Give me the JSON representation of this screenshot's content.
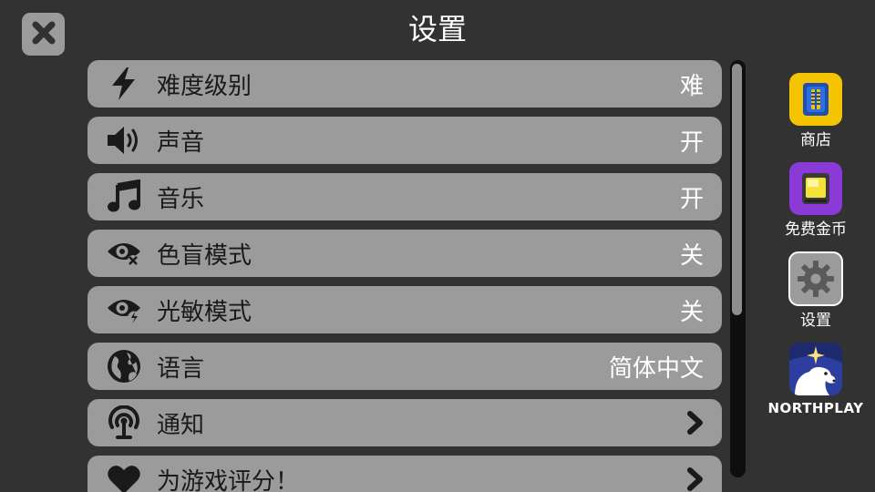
{
  "header": {
    "title": "设置"
  },
  "settings": [
    {
      "label": "难度级别",
      "value": "难",
      "icon": "lightning-icon"
    },
    {
      "label": "声音",
      "value": "开",
      "icon": "speaker-icon"
    },
    {
      "label": "音乐",
      "value": "开",
      "icon": "music-note-icon"
    },
    {
      "label": "色盲模式",
      "value": "关",
      "icon": "eye-colorblind-icon"
    },
    {
      "label": "光敏模式",
      "value": "关",
      "icon": "eye-photosensitive-icon"
    },
    {
      "label": "语言",
      "value": "简体中文",
      "icon": "globe-icon"
    },
    {
      "label": "通知",
      "value": "",
      "icon": "notification-icon"
    },
    {
      "label": "为游戏评分！",
      "value": "",
      "icon": "heart-icon"
    }
  ],
  "sidebar": {
    "shop": {
      "label": "商店",
      "icon": "shop-icon",
      "color": "#f5c400"
    },
    "free_coins": {
      "label": "免费金币",
      "icon": "tv-coins-icon",
      "color": "#8a3ad6"
    },
    "settings": {
      "label": "设置",
      "icon": "gear-icon",
      "color": "#9b9b9b"
    },
    "northplay": {
      "label": "NORTHPLAY",
      "icon": "northplay-logo-icon",
      "color": "#2c3f9e"
    }
  },
  "colors": {
    "background": "#323232",
    "row": "#9b9b9b",
    "value_text": "#ffffff"
  }
}
